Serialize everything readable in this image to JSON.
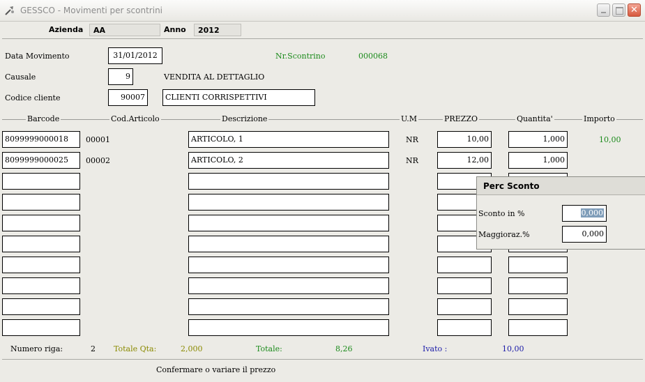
{
  "window": {
    "title": "GESSCO - Movimenti per scontrini",
    "controls": [
      "minimize-icon",
      "maximize-icon",
      "close-icon"
    ],
    "close_glyph": "✕"
  },
  "header": {
    "azienda_label": "Azienda",
    "azienda_value": "AA",
    "anno_label": "Anno",
    "anno_value": "2012"
  },
  "form": {
    "data_movimento_label": "Data Movimento",
    "data_movimento_value": "31/01/2012",
    "nr_scontrino_label": "Nr.Scontrino",
    "nr_scontrino_value": "000068",
    "causale_label": "Causale",
    "causale_code": "9",
    "causale_desc": "VENDITA AL DETTAGLIO",
    "codice_cliente_label": "Codice cliente",
    "codice_cliente_value": "90007",
    "cliente_desc": "CLIENTI CORRISPETTIVI"
  },
  "grid": {
    "columns": {
      "barcode": "Barcode",
      "cod_articolo": "Cod.Articolo",
      "descrizione": "Descrizione",
      "um": "U.M",
      "prezzo": "PREZZO",
      "quantita": "Quantita'",
      "importo": "Importo"
    },
    "rows": [
      {
        "barcode": "8099999000018",
        "cod": "00001",
        "desc": "ARTICOLO, 1",
        "um": "NR",
        "prezzo": "10,00",
        "qta": "1,000",
        "importo": "10,00"
      },
      {
        "barcode": "8099999000025",
        "cod": "00002",
        "desc": "ARTICOLO, 2",
        "um": "NR",
        "prezzo": "12,00",
        "qta": "1,000",
        "importo": ""
      }
    ]
  },
  "totals": {
    "numero_riga_label": "Numero riga:",
    "numero_riga_value": "2",
    "totale_qta_label": "Totale Qta:",
    "totale_qta_value": "2,000",
    "totale_label": "Totale:",
    "totale_value": "8,26",
    "ivato_label": "Ivato :",
    "ivato_value": "10,00"
  },
  "status": "Confermare o variare il prezzo",
  "popup": {
    "title": "Perc Sconto",
    "sconto_label": "Sconto in %",
    "sconto_value": "0,000",
    "maggioraz_label": "Maggioraz.%",
    "maggioraz_value": "0,000"
  }
}
